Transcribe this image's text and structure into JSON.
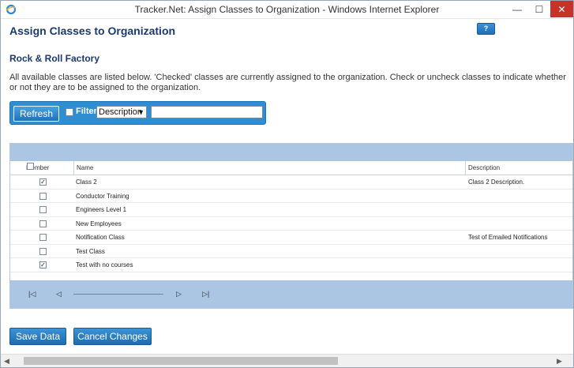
{
  "window": {
    "title": "Tracker.Net: Assign Classes to Organization - Windows Internet Explorer",
    "min": "—",
    "max": "☐",
    "close": "✕"
  },
  "page": {
    "title": "Assign Classes to Organization",
    "help": "?",
    "org_name": "Rock & Roll Factory",
    "instructions": "All available classes are listed below. 'Checked' classes are currently assigned to the organization. Check or uncheck classes to indicate whether or not they are to be assigned to the organization."
  },
  "toolbar": {
    "refresh_label": "Refresh",
    "filter_label": "Filter",
    "filter_checked": false,
    "filter_field_value": "Description",
    "filter_text_value": ""
  },
  "grid": {
    "columns": [
      "Member",
      "Name",
      "Description"
    ],
    "rows": [
      {
        "member": true,
        "name": "Class 2",
        "description": "Class 2 Description."
      },
      {
        "member": false,
        "name": "Conductor Training",
        "description": ""
      },
      {
        "member": false,
        "name": "Engineers Level 1",
        "description": ""
      },
      {
        "member": false,
        "name": "New Employees",
        "description": ""
      },
      {
        "member": false,
        "name": "Notification Class",
        "description": "Test of Emailed Notifications"
      },
      {
        "member": false,
        "name": "Test Class",
        "description": ""
      },
      {
        "member": true,
        "name": "Test with no courses",
        "description": ""
      }
    ],
    "pager": {
      "first_icon": "first-page-icon",
      "prev_icon": "previous-page-icon",
      "next_icon": "next-page-icon",
      "last_icon": "last-page-icon"
    }
  },
  "actions": {
    "save_label": "Save Data",
    "cancel_label": "Cancel Changes"
  },
  "colors": {
    "accent": "#2f8ed1",
    "grid_band": "#aac6e2",
    "title": "#1b3a6b",
    "close": "#c7322b"
  }
}
